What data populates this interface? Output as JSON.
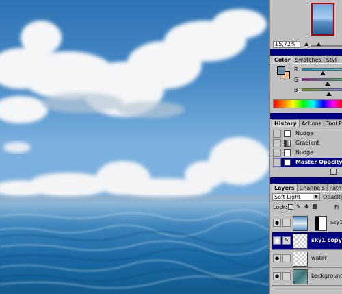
{
  "navigator": {
    "zoom": "15,72%"
  },
  "color_panel": {
    "tabs": [
      "Color",
      "Swatches",
      "Styl"
    ],
    "channels": [
      {
        "label": "R",
        "knob": 0.5
      },
      {
        "label": "G",
        "knob": 0.62
      },
      {
        "label": "B",
        "knob": 0.66
      }
    ],
    "foreground": "#6f8fa8",
    "background": "#f7c08a"
  },
  "history_panel": {
    "tabs": [
      "History",
      "Actions",
      "Tool Pr"
    ],
    "items": [
      {
        "label": "Nudge",
        "selected": false
      },
      {
        "label": "Gradient",
        "selected": false
      },
      {
        "label": "Nudge",
        "selected": false
      },
      {
        "label": "Master Opacity",
        "selected": true
      }
    ]
  },
  "layers_panel": {
    "tabs": [
      "Layers",
      "Channels",
      "Path"
    ],
    "blend_mode": "Soft Light",
    "opacity_label": "Opacity",
    "lock_label": "Lock:",
    "fill_label": "Fi",
    "layers": [
      {
        "name": "sky1",
        "selected": false
      },
      {
        "name": "sky1 copy",
        "selected": true
      },
      {
        "name": "water",
        "selected": false
      },
      {
        "name": "background",
        "selected": false
      }
    ]
  }
}
